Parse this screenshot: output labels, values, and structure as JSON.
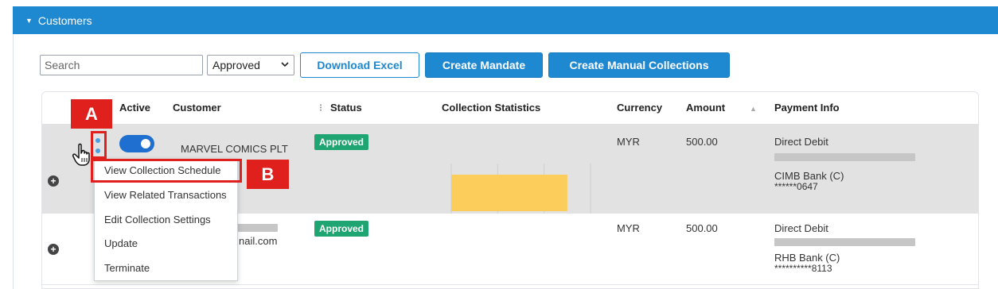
{
  "panel": {
    "title": "Customers",
    "caret_icon": "caret-down-icon"
  },
  "toolbar": {
    "search_placeholder": "Search",
    "search_value": "",
    "status_select": "Approved",
    "download_label": "Download Excel",
    "create_mandate_label": "Create Mandate",
    "create_manual_label": "Create Manual Collections"
  },
  "columns": {
    "active": "Active",
    "customer": "Customer",
    "status": "Status",
    "status_icon": "drag-handle-icon",
    "stats": "Collection Statistics",
    "currency": "Currency",
    "amount": "Amount",
    "sort_icon": "sort-up-icon",
    "payment": "Payment Info"
  },
  "rows": [
    {
      "customer": "MARVEL COMICS PLT",
      "status": "Approved",
      "currency": "MYR",
      "amount": "500.00",
      "payment_method": "Direct Debit",
      "bank": "CIMB Bank (C)",
      "account": "******0647"
    },
    {
      "customer_email": "nail.com",
      "status": "Approved",
      "currency": "MYR",
      "amount": "500.00",
      "payment_method": "Direct Debit",
      "bank": "RHB Bank (C)",
      "account": "**********8113"
    }
  ],
  "chart_data": {
    "type": "bar",
    "orientation": "horizontal",
    "categories": [
      ""
    ],
    "values": [
      125
    ],
    "xlim": [
      0,
      150
    ],
    "xticks": [
      "0",
      "50",
      "100",
      "150"
    ],
    "bar_color": "#fdcd5b",
    "grid": true
  },
  "context_menu": {
    "items": [
      "View Collection Schedule",
      "View Related Transactions",
      "Edit Collection Settings",
      "Update",
      "Terminate"
    ]
  },
  "annotations": {
    "marker_a": "A",
    "marker_b": "B"
  },
  "colors": {
    "accent": "#1e88d0",
    "approved": "#1fa572",
    "marker": "#e0201c"
  }
}
